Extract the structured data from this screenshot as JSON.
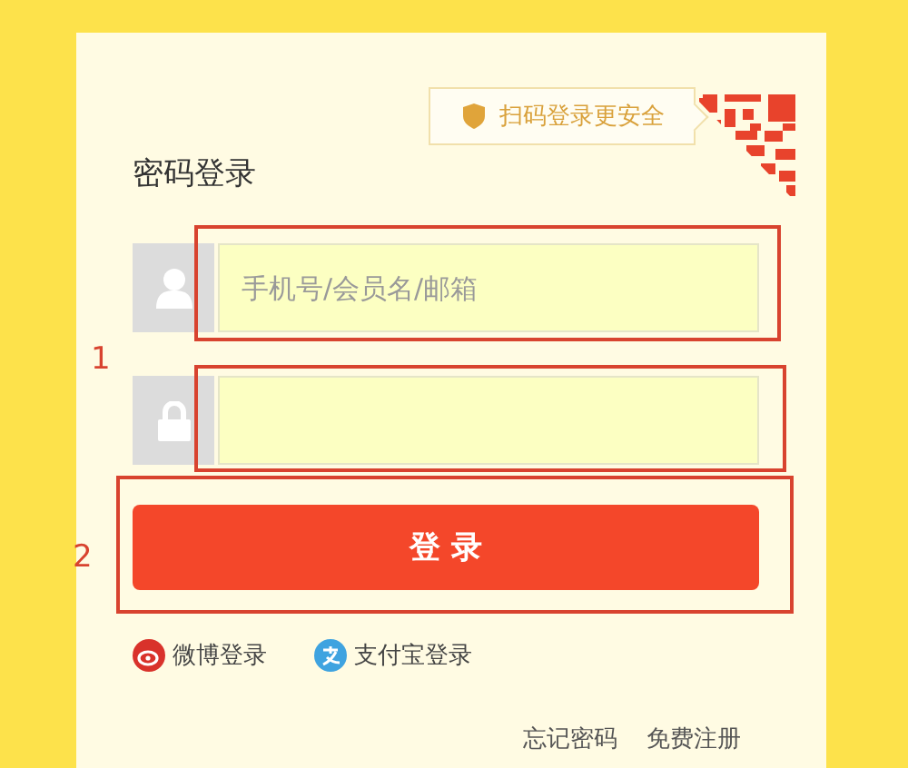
{
  "qr_hint": {
    "label": "扫码登录更安全"
  },
  "title": "密码登录",
  "fields_group": {
    "annotation": "1",
    "fields": [
      {
        "kind": "user",
        "placeholder": "手机号/会员名/邮箱"
      },
      {
        "kind": "lock"
      }
    ]
  },
  "login_button": {
    "label": "登 录",
    "annotation": "2"
  },
  "social_logins": [
    {
      "kind": "weibo",
      "label": "微博登录"
    },
    {
      "kind": "alipay",
      "label": "支付宝登录"
    }
  ],
  "links": [
    "忘记密码",
    "免费注册"
  ]
}
